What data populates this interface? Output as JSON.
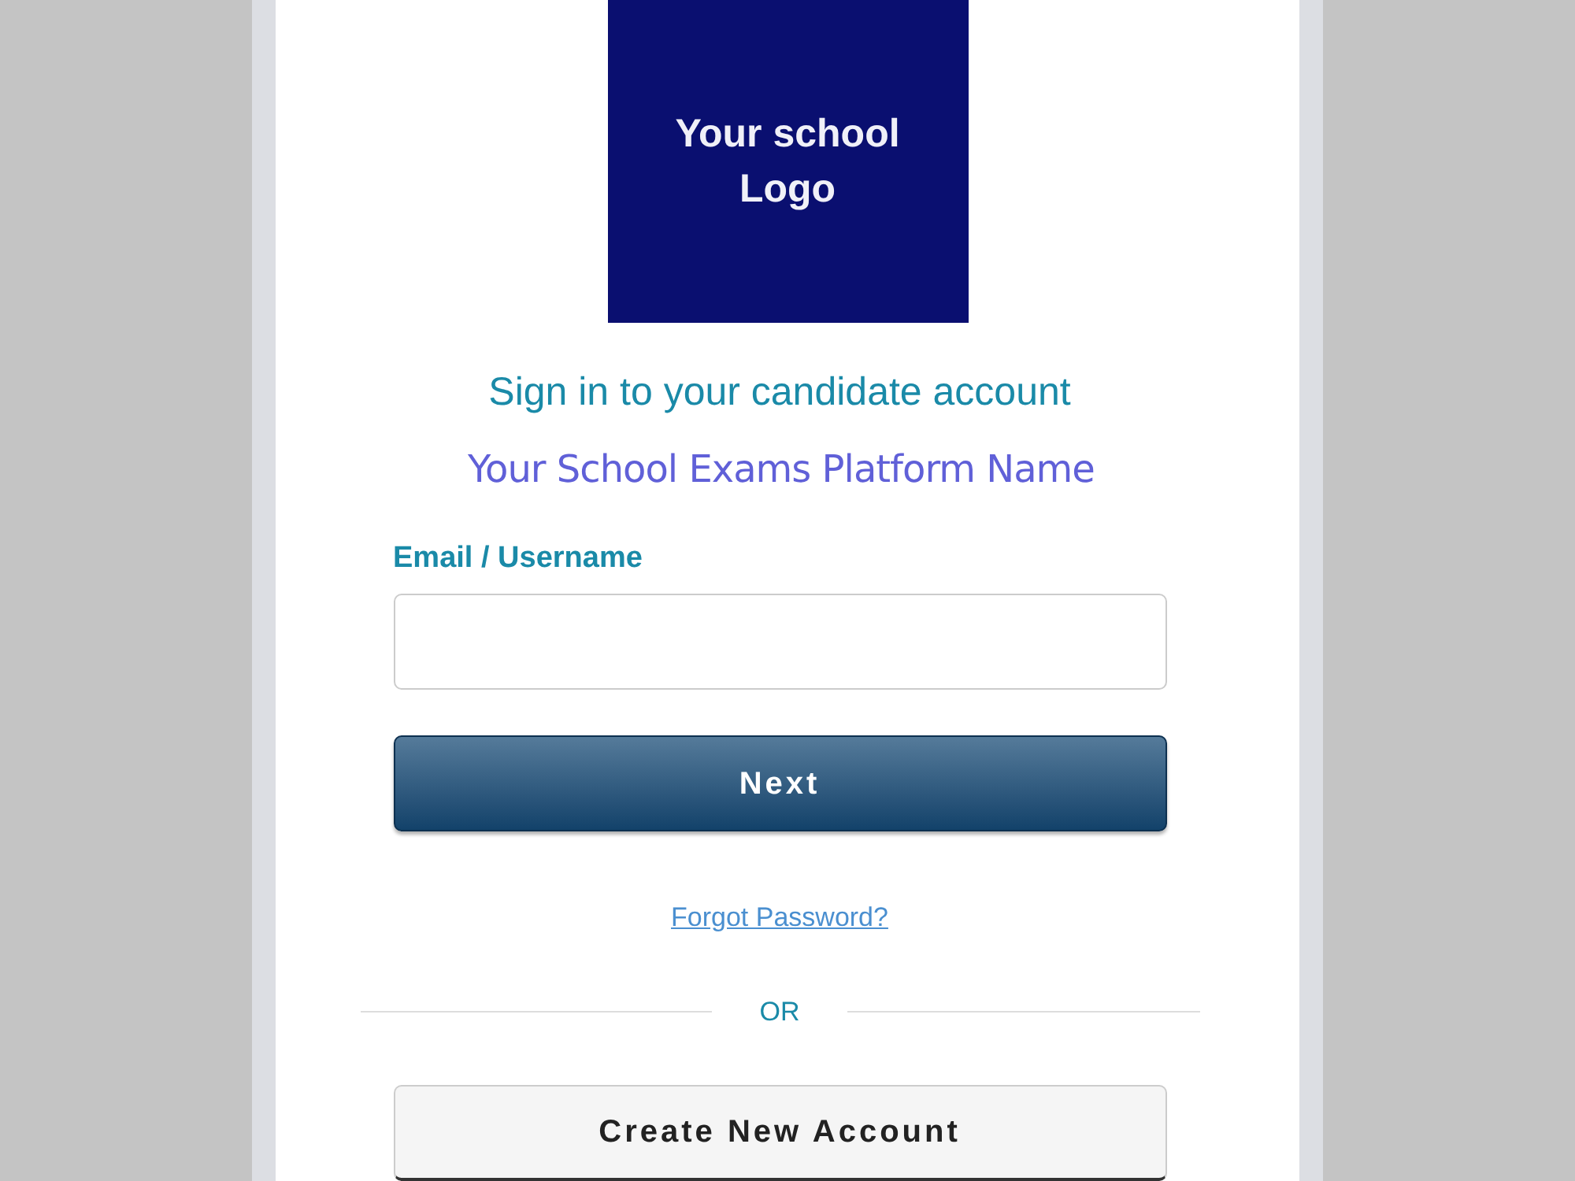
{
  "logo": {
    "text_lines": [
      "Your school",
      "Logo"
    ]
  },
  "heading": "Sign in to your candidate account",
  "platform_name": "Your School Exams Platform Name",
  "email_field": {
    "label": "Email / Username"
  },
  "next_button": "Next",
  "forgot_link": "Forgot Password?",
  "divider": "OR",
  "create_button": "Create New Account"
}
